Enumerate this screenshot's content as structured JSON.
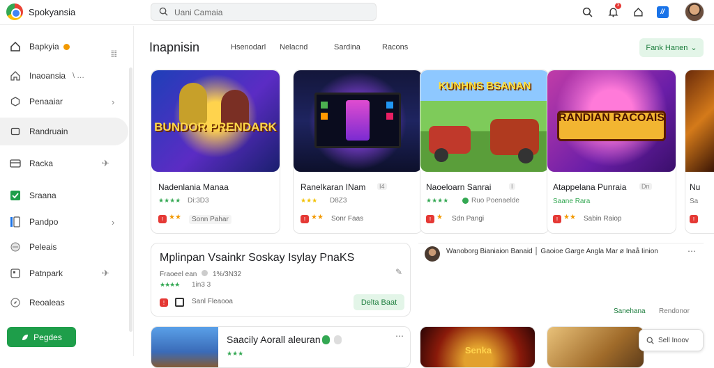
{
  "app": {
    "title": "Spokyansia"
  },
  "search": {
    "placeholder": "Uani Camaia"
  },
  "topbar": {
    "notif_count": "3",
    "blue_label": "//"
  },
  "sidebar": {
    "items": [
      {
        "label": "Bapkyia",
        "icon": "home-icon"
      },
      {
        "label": "Inaoansia",
        "extra": "\\ …",
        "icon": "home-outline-icon"
      },
      {
        "label": "Penaaiar",
        "chevron": "›",
        "icon": "hexagon-icon"
      },
      {
        "label": "Randruain",
        "icon": "square-icon"
      },
      {
        "label": "Racka",
        "chevron": "✈",
        "icon": "card-icon"
      },
      {
        "label": "Sraana",
        "icon": "check-square-icon"
      },
      {
        "label": "Pandpo",
        "chevron": "›",
        "icon": "bar-icon"
      },
      {
        "label": "Peleais",
        "icon": "circle-icon"
      },
      {
        "label": "Patnpark",
        "chevron": "✈",
        "icon": "grid-icon"
      },
      {
        "label": "Reoaleas",
        "icon": "compass-icon"
      }
    ],
    "cta": "Pegdes"
  },
  "main": {
    "title": "Inapnisin",
    "tabs": [
      "Hsenodarl",
      "Nelacnd",
      "Sardina",
      "Racons"
    ],
    "filter": "Fank Hanen"
  },
  "cards": [
    {
      "thumb_text": "BUNDOR PRENDARK",
      "name": "Nadenlania Manaa",
      "rank": "Di:3D3",
      "tag": "Sonn Pahar",
      "badge": ""
    },
    {
      "thumb_text": "",
      "name": "Ranelkaran INam",
      "rank": "D8Z3",
      "tag": "Sonr  Faas",
      "badge": "I4"
    },
    {
      "thumb_text": "KUNHNS BSANAN",
      "name": "Naoeloarn Sanrai",
      "rank": "Ruo Poenaelde",
      "tag": "Sdn Pangi",
      "badge": "I"
    },
    {
      "thumb_text": "RANDIAN RACOAIS",
      "name": "Atappelana Punraia",
      "rank": "Saane  Rara",
      "tag": "Sabin Raiop",
      "badge": "Dn"
    },
    {
      "thumb_text": "",
      "name": "Nu",
      "rank": "Sa",
      "tag": "",
      "badge": ""
    }
  ],
  "featured": {
    "title": "Mplinpan Vsainkr Soskay Isylay PnaKS",
    "subtitle": "Fraoeel ean",
    "rank_sub": "1%/3N32",
    "rank": "1in3 3",
    "save": "Sanl Fleaooa",
    "action": "Delta Baat"
  },
  "review": {
    "text": "Wanoborg Bianiaion Banaid │ Gaoioe Garge Angla Mar ø Inaå Iinion",
    "link1": "Sanehana",
    "link2": "Rendonor"
  },
  "bottom": {
    "card1_title": "Saacily Aorall aleuran",
    "card3_label": "Senka",
    "float_search": "Sell Inoov"
  }
}
